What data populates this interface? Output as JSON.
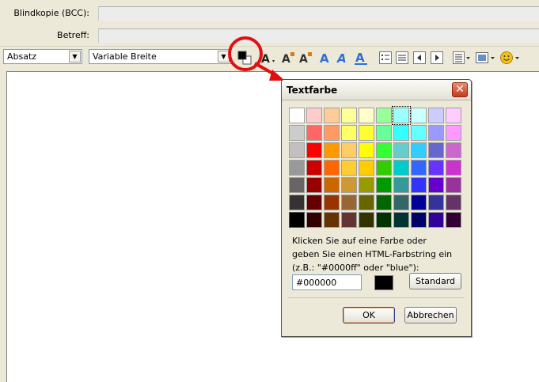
{
  "header": {
    "bcc_label": "Blindkopie (BCC):",
    "subject_label": "Betreff:"
  },
  "toolbar": {
    "paragraph_select": "Absatz",
    "font_select": "Variable Breite",
    "icons": [
      "text-color-icon",
      "highlight-icon",
      "font-smaller-icon",
      "font-larger-icon",
      "bold-icon",
      "italic-icon",
      "underline-icon",
      "bulleted-list-icon",
      "numbered-list-icon",
      "outdent-icon",
      "indent-icon",
      "align-icon",
      "insert-image-icon",
      "emoticon-icon"
    ]
  },
  "dialog": {
    "title": "Textfarbe",
    "hint_line1": "Klicken Sie auf eine Farbe oder",
    "hint_line2": "geben Sie einen HTML-Farbstring ein",
    "hint_line3": "(z.B.: \"#0000ff\" oder \"blue\"):",
    "hex_value": "#000000",
    "standard_label": "Standard",
    "ok_label": "OK",
    "cancel_label": "Abbrechen",
    "selected_color": "#000000",
    "palette": [
      [
        "#ffffff",
        "#ffcccc",
        "#ffcc99",
        "#ffff99",
        "#ffffcc",
        "#99ff99",
        "#99ffff",
        "#ccffff",
        "#ccccff",
        "#ffccff"
      ],
      [
        "#cccccc",
        "#ff6666",
        "#ff9966",
        "#ffff66",
        "#ffff33",
        "#66ff99",
        "#33ffff",
        "#66ffff",
        "#9999ff",
        "#ff99ff"
      ],
      [
        "#c0c0c0",
        "#ff0000",
        "#ff9900",
        "#ffcc66",
        "#ffff00",
        "#33ff33",
        "#66cccc",
        "#33ccff",
        "#6666cc",
        "#cc66cc"
      ],
      [
        "#999999",
        "#cc0000",
        "#ff6600",
        "#ffcc33",
        "#ffcc00",
        "#33cc00",
        "#00cccc",
        "#3366ff",
        "#6633ff",
        "#cc33cc"
      ],
      [
        "#666666",
        "#990000",
        "#cc6600",
        "#cc9933",
        "#999900",
        "#009900",
        "#339999",
        "#3333ff",
        "#6600cc",
        "#993399"
      ],
      [
        "#333333",
        "#660000",
        "#993300",
        "#996633",
        "#666600",
        "#006600",
        "#336666",
        "#000099",
        "#333399",
        "#663366"
      ],
      [
        "#000000",
        "#330000",
        "#663300",
        "#663333",
        "#333300",
        "#003300",
        "#003333",
        "#000066",
        "#330099",
        "#330033"
      ]
    ],
    "highlighted_swatch": [
      0,
      6
    ]
  }
}
